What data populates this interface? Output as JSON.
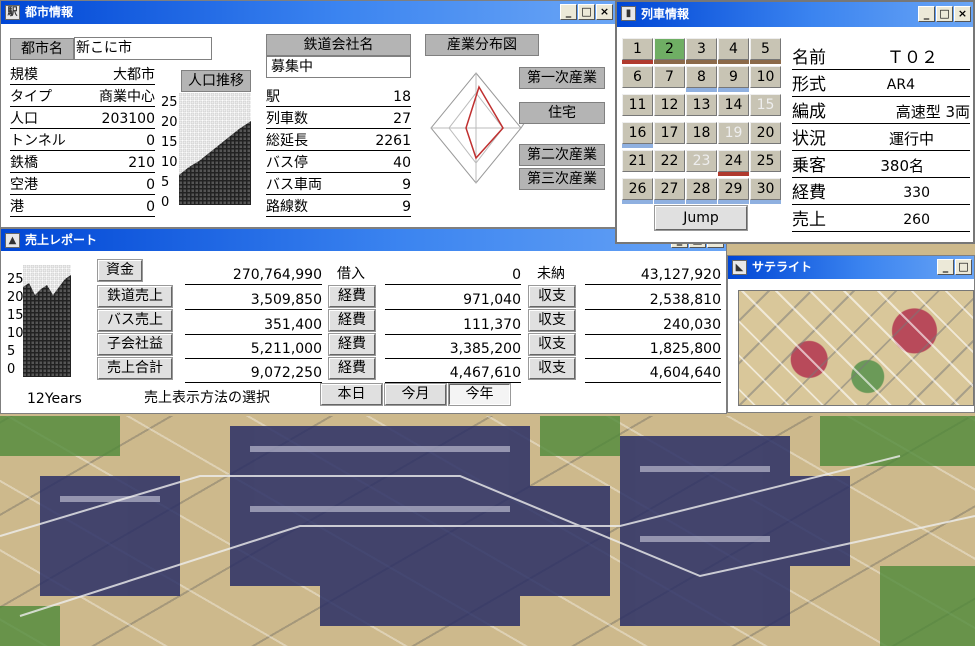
{
  "city_window": {
    "title": "都市情報",
    "name_label": "都市名",
    "name_value": "新こに市",
    "stats": [
      {
        "label": "規模",
        "value": "大都市"
      },
      {
        "label": "タイプ",
        "value": "商業中心"
      },
      {
        "label": "人口",
        "value": "203100"
      },
      {
        "label": "トンネル",
        "value": "0"
      },
      {
        "label": "鉄橋",
        "value": "210"
      },
      {
        "label": "空港",
        "value": "0"
      },
      {
        "label": "港",
        "value": "0"
      }
    ],
    "pop_trend_label": "人口推移",
    "pop_axis": [
      "25",
      "20",
      "15",
      "10",
      "5",
      "0"
    ],
    "rail_company_label": "鉄道会社名",
    "rail_company_value": "募集中",
    "rail_stats": [
      {
        "label": "駅",
        "value": "18"
      },
      {
        "label": "列車数",
        "value": "27"
      },
      {
        "label": "総延長",
        "value": "2261"
      },
      {
        "label": "バス停",
        "value": "40"
      },
      {
        "label": "バス車両",
        "value": "9"
      },
      {
        "label": "路線数",
        "value": "9"
      }
    ],
    "industry_label": "産業分布図",
    "industry_axes": [
      "第一次産業",
      "住宅",
      "第二次産業",
      "第三次産業"
    ]
  },
  "train_window": {
    "title": "列車情報",
    "days": [
      "1",
      "2",
      "3",
      "4",
      "5",
      "6",
      "7",
      "8",
      "9",
      "10",
      "11",
      "12",
      "13",
      "14",
      "15",
      "16",
      "17",
      "18",
      "19",
      "20",
      "21",
      "22",
      "23",
      "24",
      "25",
      "26",
      "27",
      "28",
      "29",
      "30"
    ],
    "jump_label": "Jump",
    "info": [
      {
        "label": "名前",
        "value": "Ｔ０２"
      },
      {
        "label": "形式",
        "value": "AR4"
      },
      {
        "label": "編成",
        "value": "高速型 3両"
      },
      {
        "label": "状況",
        "value": "運行中"
      },
      {
        "label": "乗客",
        "value": "380名"
      },
      {
        "label": "経費",
        "value": "330"
      },
      {
        "label": "売上",
        "value": "260"
      }
    ]
  },
  "sales_window": {
    "title": "売上レポート",
    "axis": [
      "25",
      "20",
      "15",
      "10",
      "5",
      "0"
    ],
    "years_label": "12Years",
    "col1": [
      {
        "label": "資金",
        "value": "270,764,990"
      },
      {
        "label": "鉄道売上",
        "value": "3,509,850"
      },
      {
        "label": "バス売上",
        "value": "351,400"
      },
      {
        "label": "子会社益",
        "value": "5,211,000"
      },
      {
        "label": "売上合計",
        "value": "9,072,250"
      }
    ],
    "col2": [
      {
        "label": "借入",
        "value": "0"
      },
      {
        "label": "経費",
        "value": "971,040"
      },
      {
        "label": "経費",
        "value": "111,370"
      },
      {
        "label": "経費",
        "value": "3,385,200"
      },
      {
        "label": "経費",
        "value": "4,467,610"
      }
    ],
    "col3": [
      {
        "label": "未納",
        "value": "43,127,920"
      },
      {
        "label": "収支",
        "value": "2,538,810"
      },
      {
        "label": "収支",
        "value": "240,030"
      },
      {
        "label": "収支",
        "value": "1,825,800"
      },
      {
        "label": "収支",
        "value": "4,604,640"
      }
    ],
    "display_method_label": "売上表示方法の選択",
    "period_buttons": [
      "本日",
      "今月",
      "今年"
    ]
  },
  "satellite_window": {
    "title": "サテライト"
  },
  "colors": {
    "titlebar": "#0046d5",
    "calendar_active": "#6fae64",
    "bar_red": "#b03a2e",
    "bar_blue": "#8fb0e0",
    "bar_brown": "#8b6a4a"
  }
}
